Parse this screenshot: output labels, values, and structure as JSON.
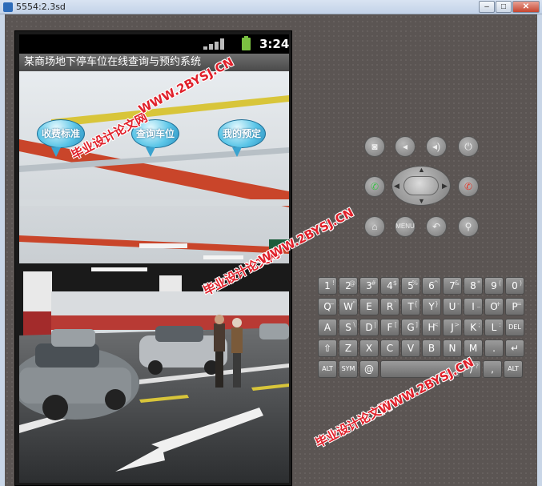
{
  "window": {
    "title": "5554:2.3sd",
    "minimize": "–",
    "maximize": "□",
    "close": "✕"
  },
  "phone": {
    "clock": "3:24",
    "app_title": "某商场地下停车位在线查询与预约系统",
    "buttons": [
      {
        "label": "收费标准"
      },
      {
        "label": "查询车位"
      },
      {
        "label": "我的预定"
      }
    ]
  },
  "watermark": {
    "text_cn": "毕业设计论文网",
    "text_url": "WWW.2BYSJ.CN"
  },
  "controls": {
    "menu_label": "MENU"
  },
  "keyboard": {
    "rows": [
      [
        {
          "k": "1",
          "a": "!"
        },
        {
          "k": "2",
          "a": "@"
        },
        {
          "k": "3",
          "a": "#"
        },
        {
          "k": "4",
          "a": "$"
        },
        {
          "k": "5",
          "a": "%"
        },
        {
          "k": "6",
          "a": "^"
        },
        {
          "k": "7",
          "a": "&"
        },
        {
          "k": "8",
          "a": "*"
        },
        {
          "k": "9",
          "a": "("
        },
        {
          "k": "0",
          "a": ")"
        }
      ],
      [
        {
          "k": "Q",
          "a": "~"
        },
        {
          "k": "W",
          "a": "\""
        },
        {
          "k": "E",
          "a": ""
        },
        {
          "k": "R",
          "a": "`"
        },
        {
          "k": "T",
          "a": "{"
        },
        {
          "k": "Y",
          "a": "}"
        },
        {
          "k": "U",
          "a": "-"
        },
        {
          "k": "I",
          "a": "_"
        },
        {
          "k": "O",
          "a": "+"
        },
        {
          "k": "P",
          "a": "="
        }
      ],
      [
        {
          "k": "A",
          "a": ""
        },
        {
          "k": "S",
          "a": "\\"
        },
        {
          "k": "D",
          "a": "|"
        },
        {
          "k": "F",
          "a": "["
        },
        {
          "k": "G",
          "a": "]"
        },
        {
          "k": "H",
          "a": "<"
        },
        {
          "k": "J",
          "a": ">"
        },
        {
          "k": "K",
          "a": ";"
        },
        {
          "k": "L",
          "a": ":"
        },
        {
          "k": "DEL",
          "a": ""
        }
      ],
      [
        {
          "k": "⇧",
          "a": ""
        },
        {
          "k": "Z",
          "a": ""
        },
        {
          "k": "X",
          "a": ""
        },
        {
          "k": "C",
          "a": ""
        },
        {
          "k": "V",
          "a": ""
        },
        {
          "k": "B",
          "a": ""
        },
        {
          "k": "N",
          "a": ""
        },
        {
          "k": "M",
          "a": ""
        },
        {
          "k": ".",
          "a": ""
        },
        {
          "k": "↵",
          "a": ""
        }
      ],
      [
        {
          "k": "ALT",
          "a": ""
        },
        {
          "k": "SYM",
          "a": ""
        },
        {
          "k": "@",
          "a": ""
        },
        {
          "k": "",
          "a": ""
        },
        {
          "k": "/",
          "a": "?"
        },
        {
          "k": ",",
          "a": ""
        },
        {
          "k": "ALT",
          "a": ""
        }
      ]
    ]
  }
}
